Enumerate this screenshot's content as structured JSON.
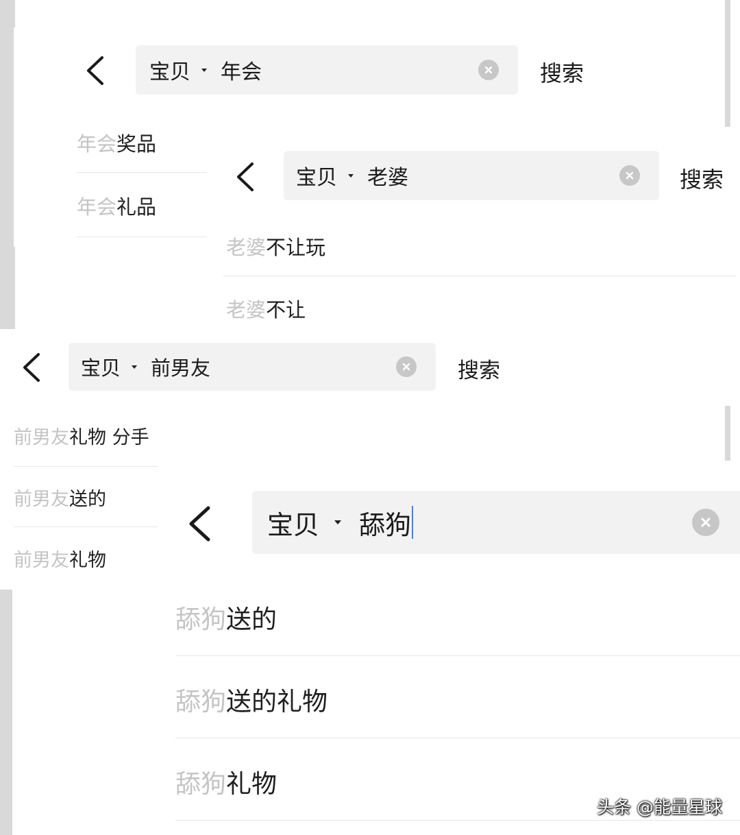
{
  "panels": [
    {
      "id": "panel-1",
      "scope_label": "宝贝",
      "query": "年会",
      "search_label": "搜索",
      "suggestions": [
        {
          "hit": "年会",
          "rest": "奖品"
        },
        {
          "hit": "年会",
          "rest": "礼品"
        }
      ]
    },
    {
      "id": "panel-2",
      "scope_label": "宝贝",
      "query": "老婆",
      "search_label": "搜索",
      "suggestions": [
        {
          "hit": "老婆",
          "rest": "不让玩"
        },
        {
          "hit": "老婆",
          "rest": "不让"
        }
      ]
    },
    {
      "id": "panel-3",
      "scope_label": "宝贝",
      "query": "前男友",
      "search_label": "搜索",
      "suggestions": [
        {
          "hit": "前男友",
          "rest": "礼物 分手"
        },
        {
          "hit": "前男友",
          "rest": "送的"
        },
        {
          "hit": "前男友",
          "rest": "礼物"
        }
      ]
    },
    {
      "id": "panel-4",
      "scope_label": "宝贝",
      "query": "舔狗",
      "suggestions": [
        {
          "hit": "舔狗",
          "rest": "送的"
        },
        {
          "hit": "舔狗",
          "rest": "送的礼物"
        },
        {
          "hit": "舔狗",
          "rest": "礼物"
        }
      ]
    }
  ],
  "watermark": "头条 @能量星球",
  "icons": {
    "back": "chevron-left-icon",
    "dropdown": "caret-down-icon",
    "clear": "clear-circle-icon"
  },
  "colors": {
    "search_field_bg": "#f2f2f2",
    "matched_text": "#c4c4c4",
    "suggestion_text": "#1f1f1f",
    "cursor": "#3b82f6"
  }
}
